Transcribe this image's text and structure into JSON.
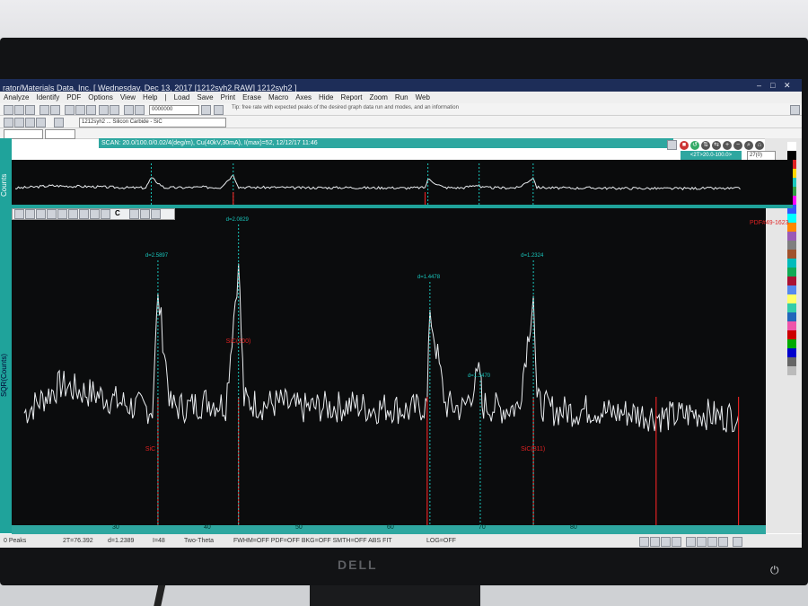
{
  "window": {
    "title": "rator/Materials Data, Inc. [ Wednesday, Dec 13, 2017 [1212syh2.RAW] 1212syh2 ]"
  },
  "menu": [
    "Analyze",
    "Identify",
    "PDF",
    "Options",
    "View",
    "Help",
    "|",
    "Load",
    "Save",
    "Print",
    "Erase",
    "Macro",
    "Axes",
    "Hide",
    "Report",
    "Zoom",
    "Run",
    "Web"
  ],
  "toolbar": {
    "zoom_value": "0000000",
    "hint_text": "Tip: free rate with expected peaks of the desired graph data run and modes, and an information",
    "file_field": "1212syh2 ... Silicon Carbide - SiC"
  },
  "scan": {
    "text": "SCAN: 20.0/100.0/0.02/4(deg/m), Cu(40kV,30mA), I(max)=52, 12/12/17 11:46"
  },
  "overview": {
    "label": "Counts",
    "range_label": "<2T>20.0-100.0>",
    "count": "27(0)"
  },
  "main": {
    "ylabel": "SQR(Counts)",
    "pdf_ref": "PDF#49-1623",
    "tool_label": "C"
  },
  "peaks_d": [
    "d=2.5897",
    "d=2.0829",
    "d=1.4478",
    "d=1.3470",
    "d=1.2324"
  ],
  "phase_labels": [
    "SiC(200)",
    "SiC",
    "SiC(311)"
  ],
  "xaxis_ticks": [
    "30",
    "40",
    "50",
    "60",
    "70",
    "80"
  ],
  "statusbar": {
    "peaks": "0 Peaks",
    "position": "2T=76.392",
    "dspacing": "d=1.2389",
    "intensity": "I=48",
    "mode": "Two-Theta",
    "toggles": "FWHM=OFF  PDF=OFF  BKG=OFF  SMTH=OFF  ABS  FIT",
    "log": "LOG=OFF"
  },
  "monitor": {
    "brand": "DELL",
    "power_icon": "power-icon"
  },
  "colors": {
    "teal": "#1fa39b",
    "plot_bg": "#0b0c0d",
    "trace": "#e9ecef",
    "peak_marker": "#19c7bd",
    "reference": "#e02222"
  },
  "chart_data": {
    "type": "line",
    "title": "",
    "xlabel": "",
    "ylabel": "SQR(Counts)",
    "xlim": [
      20,
      100
    ],
    "series": [
      {
        "name": "",
        "x": [
          20,
          22,
          24,
          26,
          28,
          30,
          32,
          34,
          34.6,
          36,
          38,
          40,
          42,
          43.4,
          44,
          46,
          48,
          50,
          52,
          54,
          56,
          58,
          60,
          62,
          64,
          64.3,
          66,
          68,
          69.8,
          70,
          72,
          74,
          75.6,
          76,
          78,
          80,
          82,
          84,
          86,
          88,
          90,
          92,
          94,
          96,
          98
        ],
        "y": [
          3.2,
          3.9,
          4.6,
          4.3,
          4.1,
          3.8,
          3.5,
          3.4,
          9.1,
          3.5,
          3.5,
          3.8,
          3.6,
          10.6,
          3.8,
          3.6,
          3.7,
          3.4,
          3.5,
          3.5,
          3.6,
          3.4,
          3.5,
          3.3,
          3.6,
          8.3,
          3.6,
          3.4,
          5.2,
          3.6,
          3.4,
          3.5,
          9.0,
          3.7,
          3.3,
          3.3,
          3.4,
          3.2,
          3.2,
          3.1,
          3.0,
          3.1,
          3.2,
          3.0,
          3.1
        ]
      }
    ],
    "peak_markers": [
      {
        "x": 34.6,
        "label": "d=2.5897"
      },
      {
        "x": 43.4,
        "label": "d=2.0829"
      },
      {
        "x": 64.3,
        "label": "d=1.4478"
      },
      {
        "x": 69.8,
        "label": "d=1.3470"
      },
      {
        "x": 75.6,
        "label": "d=1.2324"
      }
    ],
    "reference_lines": [
      {
        "x": 34.6,
        "label": "SiC"
      },
      {
        "x": 43.4,
        "label": "SiC(200)"
      },
      {
        "x": 64.0,
        "label": ""
      },
      {
        "x": 75.6,
        "label": "SiC(311)"
      },
      {
        "x": 89.0,
        "label": ""
      },
      {
        "x": 98.0,
        "label": ""
      }
    ],
    "x_ticks": [
      30,
      40,
      50,
      60,
      70,
      80
    ]
  }
}
